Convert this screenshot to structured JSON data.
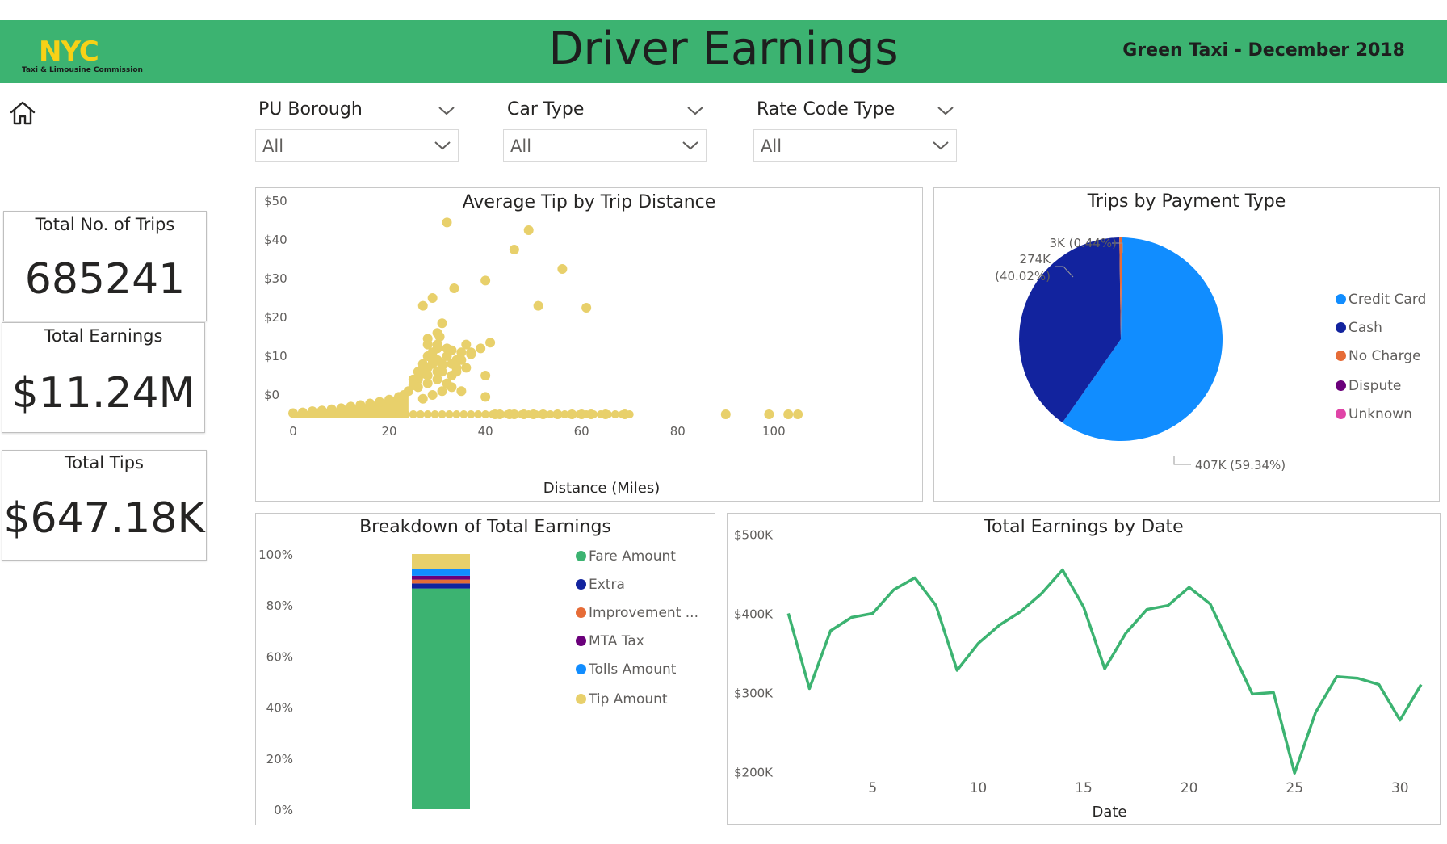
{
  "header": {
    "logo_text": "NYC",
    "logo_subtext": "Taxi & Limousine Commission",
    "title": "Driver Earnings",
    "subtitle": "Green Taxi - December 2018",
    "color": "#3cb371"
  },
  "nav": {
    "home_icon": "home-icon"
  },
  "filters": [
    {
      "label": "PU Borough",
      "value": "All"
    },
    {
      "label": "Car Type",
      "value": "All"
    },
    {
      "label": "Rate Code Type",
      "value": "All"
    }
  ],
  "cards": {
    "trips": {
      "title": "Total No. of Trips",
      "value": "685241"
    },
    "earnings": {
      "title": "Total Earnings",
      "value": "$11.24M"
    },
    "tips": {
      "title": "Total Tips",
      "value": "$647.18K"
    }
  },
  "scatter": {
    "title": "Average Tip by Trip Distance",
    "xlabel": "Distance (Miles)",
    "y_ticks": [
      "$50",
      "$40",
      "$30",
      "$20",
      "$10",
      "$0"
    ],
    "x_ticks": [
      "0",
      "20",
      "40",
      "60",
      "80",
      "100"
    ],
    "color": "#e8d06b"
  },
  "pie": {
    "title": "Trips by Payment Type",
    "labels": {
      "cash": "274K",
      "cash_pct": "(40.02%)",
      "credit": "407K (59.34%)",
      "small": "3K (0.44%)"
    },
    "legend": [
      {
        "name": "Credit Card",
        "color": "#118dff"
      },
      {
        "name": "Cash",
        "color": "#12239e"
      },
      {
        "name": "No Charge",
        "color": "#e66c37"
      },
      {
        "name": "Dispute",
        "color": "#6b007b"
      },
      {
        "name": "Unknown",
        "color": "#e044a7"
      }
    ]
  },
  "breakdown": {
    "title": "Breakdown of Total Earnings",
    "y_ticks": [
      "100%",
      "80%",
      "60%",
      "40%",
      "20%",
      "0%"
    ],
    "legend": [
      {
        "name": "Fare Amount",
        "color": "#3cb371"
      },
      {
        "name": "Extra",
        "color": "#12239e"
      },
      {
        "name": "Improvement ...",
        "color": "#e66c37"
      },
      {
        "name": "MTA Tax",
        "color": "#6b007b"
      },
      {
        "name": "Tolls Amount",
        "color": "#118dff"
      },
      {
        "name": "Tip Amount",
        "color": "#e8d06b"
      }
    ]
  },
  "line": {
    "title": "Total Earnings by Date",
    "xlabel": "Date",
    "y_ticks": [
      "$500K",
      "$400K",
      "$300K",
      "$200K"
    ],
    "x_ticks": [
      "5",
      "10",
      "15",
      "20",
      "25",
      "30"
    ],
    "color": "#3cb371"
  },
  "chart_data": [
    {
      "type": "scatter",
      "title": "Average Tip by Trip Distance",
      "xlabel": "Distance (Miles)",
      "ylabel": "",
      "xlim": [
        0,
        107
      ],
      "ylim": [
        0,
        50
      ],
      "x": [
        0,
        2,
        4,
        6,
        8,
        10,
        12,
        14,
        16,
        18,
        20,
        22,
        23,
        24,
        25,
        26,
        27,
        27,
        28,
        28,
        29,
        29,
        30,
        30,
        31,
        32,
        32,
        33,
        33,
        34,
        35,
        36,
        37,
        40,
        40,
        41,
        42,
        43,
        45,
        46,
        48,
        50,
        52,
        55,
        58,
        60,
        62,
        65,
        69,
        90,
        99,
        103,
        105,
        32,
        33.5,
        40,
        46,
        49,
        51,
        56,
        61,
        27,
        28,
        29,
        30,
        30.5,
        31
      ],
      "y": [
        0.3,
        0.5,
        0.8,
        1.0,
        1.3,
        1.6,
        2.0,
        2.4,
        2.8,
        3.2,
        3.8,
        4.5,
        5.0,
        6.0,
        7.5,
        9.0,
        10.5,
        13.0,
        12.0,
        15.0,
        14.0,
        16.0,
        17.0,
        11.0,
        12.5,
        17.0,
        15.0,
        13.0,
        16.5,
        14.0,
        16.0,
        18.0,
        15.5,
        10.0,
        4.5,
        18.5,
        0,
        0,
        0,
        0,
        0,
        0,
        0,
        0,
        0,
        0,
        0,
        0,
        0,
        0,
        0,
        0,
        0,
        49.5,
        32.5,
        34.5,
        42.5,
        47.5,
        28.0,
        37.5,
        27.5,
        28.0,
        19.5,
        30.0,
        21.0,
        20.0,
        23.5
      ],
      "grid": false
    },
    {
      "type": "pie",
      "title": "Trips by Payment Type",
      "categories": [
        "Credit Card",
        "Cash",
        "No Charge",
        "Dispute",
        "Unknown"
      ],
      "values": [
        407,
        274,
        3,
        0.1,
        0.05
      ],
      "percent": [
        59.34,
        40.02,
        0.44,
        0.13,
        0.07
      ],
      "legend": "right"
    },
    {
      "type": "bar",
      "title": "Breakdown of Total Earnings",
      "categories": [
        ""
      ],
      "series": [
        {
          "name": "Fare Amount",
          "values": [
            86.5
          ]
        },
        {
          "name": "Extra",
          "values": [
            2.0
          ]
        },
        {
          "name": "Improvement ...",
          "values": [
            1.5
          ]
        },
        {
          "name": "MTA Tax",
          "values": [
            1.5
          ]
        },
        {
          "name": "Tolls Amount",
          "values": [
            2.7
          ]
        },
        {
          "name": "Tip Amount",
          "values": [
            5.8
          ]
        }
      ],
      "stacked": true,
      "ylim": [
        0,
        100
      ],
      "legend": "right"
    },
    {
      "type": "line",
      "title": "Total Earnings by Date",
      "xlabel": "Date",
      "ylabel": "",
      "x": [
        1,
        2,
        3,
        4,
        5,
        6,
        7,
        8,
        9,
        10,
        11,
        12,
        13,
        14,
        15,
        16,
        17,
        18,
        19,
        20,
        21,
        22,
        23,
        24,
        25,
        26,
        27,
        28,
        29,
        30,
        31
      ],
      "y": [
        400000,
        305000,
        378000,
        395000,
        400000,
        430000,
        445000,
        410000,
        328000,
        362000,
        385000,
        402000,
        425000,
        455000,
        408000,
        330000,
        375000,
        405000,
        410000,
        433000,
        412000,
        355000,
        298000,
        300000,
        198000,
        275000,
        320000,
        318000,
        310000,
        265000,
        310000
      ],
      "ylim": [
        140000,
        520000
      ],
      "xlim": [
        -1.5,
        31.5
      ],
      "grid": false
    }
  ]
}
